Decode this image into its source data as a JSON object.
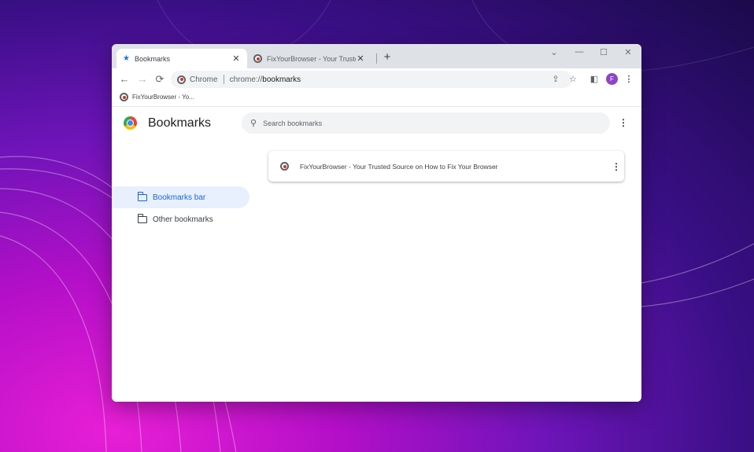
{
  "tabs": [
    {
      "title": "Bookmarks",
      "icon": "star-icon"
    },
    {
      "title": "FixYourBrowser - Your Trusted Sc",
      "icon": "fixyourbrowser-favicon"
    }
  ],
  "toolbar": {
    "chip_label": "Chrome",
    "url_scheme": "chrome://",
    "url_path": "bookmarks",
    "avatar_letter": "F"
  },
  "bookmarks_bar": {
    "items": [
      {
        "label": "FixYourBrowser - Yo..."
      }
    ]
  },
  "page": {
    "title": "Bookmarks",
    "search_placeholder": "Search bookmarks"
  },
  "sidebar": {
    "items": [
      {
        "label": "Bookmarks bar",
        "selected": true
      },
      {
        "label": "Other bookmarks",
        "selected": false
      }
    ]
  },
  "bookmark_list": [
    {
      "title": "FixYourBrowser - Your Trusted Source on How to Fix Your Browser"
    }
  ],
  "colors": {
    "accent": "#1967d2",
    "selected_bg": "#e8f0fe",
    "tabstrip": "#dee1e6",
    "avatar": "#8e44c7"
  }
}
